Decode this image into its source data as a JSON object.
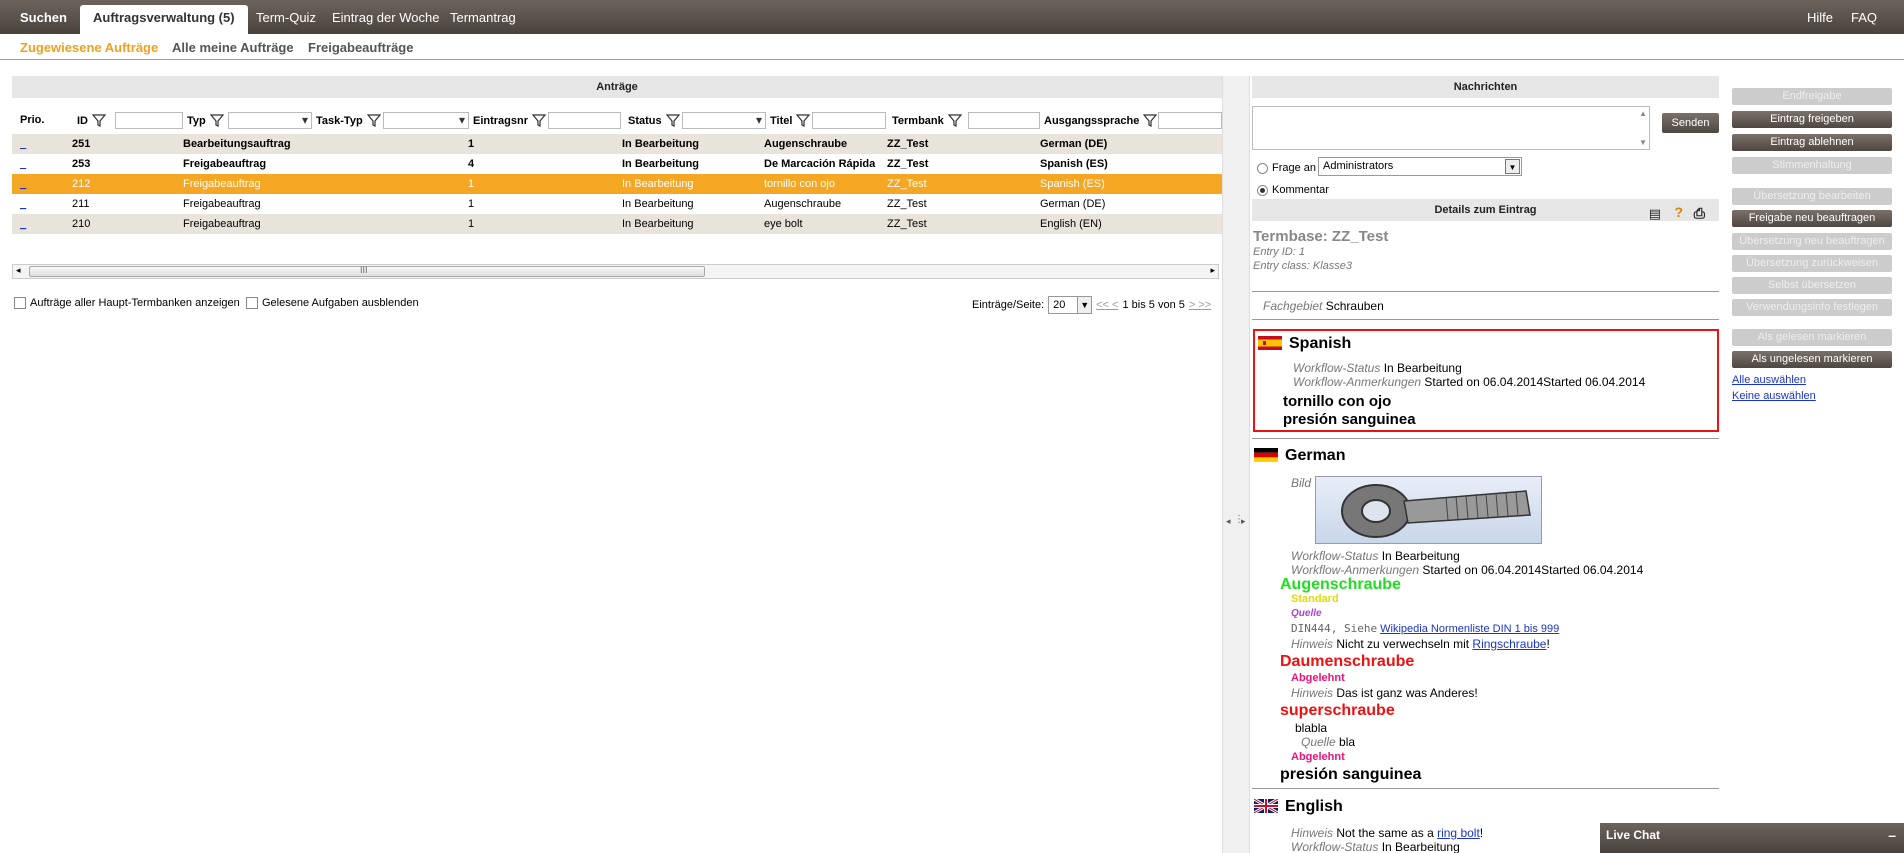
{
  "topnav": {
    "items": [
      "Suchen",
      "Auftragsverwaltung (5)",
      "Term-Quiz",
      "Eintrag der Woche",
      "Termantrag"
    ],
    "right": [
      "Hilfe",
      "FAQ"
    ]
  },
  "subnav": [
    "Zugewiesene Aufträge",
    "Alle meine Aufträge",
    "Freigabeaufträge"
  ],
  "left": {
    "title": "Anträge",
    "columns": [
      "Prio.",
      "ID",
      "Typ",
      "Task-Typ",
      "Eintragsnr",
      "Status",
      "Titel",
      "Termbank",
      "Ausgangssprache"
    ],
    "rows": [
      {
        "prio": "_",
        "id": "251",
        "typ": "Bearbeitungsauftrag",
        "nr": "1",
        "status": "In Bearbeitung",
        "titel": "Augenschraube",
        "termbank": "ZZ_Test",
        "sprache": "German (DE)"
      },
      {
        "prio": "_",
        "id": "253",
        "typ": "Freigabeauftrag",
        "nr": "4",
        "status": "In Bearbeitung",
        "titel": "De Marcación Rápida",
        "termbank": "ZZ_Test",
        "sprache": "Spanish (ES)"
      },
      {
        "prio": "_",
        "id": "212",
        "typ": "Freigabeauftrag",
        "nr": "1",
        "status": "In Bearbeitung",
        "titel": "tornillo con ojo",
        "termbank": "ZZ_Test",
        "sprache": "Spanish (ES)"
      },
      {
        "prio": "_",
        "id": "211",
        "typ": "Freigabeauftrag",
        "nr": "1",
        "status": "In Bearbeitung",
        "titel": "Augenschraube",
        "termbank": "ZZ_Test",
        "sprache": "German (DE)"
      },
      {
        "prio": "_",
        "id": "210",
        "typ": "Freigabeauftrag",
        "nr": "1",
        "status": "In Bearbeitung",
        "titel": "eye bolt",
        "termbank": "ZZ_Test",
        "sprache": "English (EN)"
      }
    ],
    "scroll_label": "III",
    "check_all_label": "Aufträge aller Haupt-Termbanken anzeigen",
    "check_read_label": "Gelesene Aufgaben ausblenden",
    "per_page_label": "Einträge/Seite:",
    "per_page_value": "20",
    "pager_prev": "<< <",
    "pager_text": "1 bis 5 von 5",
    "pager_next": "> >>"
  },
  "messages": {
    "title": "Nachrichten",
    "send": "Senden",
    "ask_label": "Frage an",
    "ask_value": "Administrators",
    "comment_label": "Kommentar"
  },
  "details": {
    "title": "Details zum Eintrag",
    "termbase": "Termbase: ZZ_Test",
    "entry_id": "Entry ID: 1",
    "entry_class": "Entry class: Klasse3",
    "fach_label": "Fachgebiet",
    "fach_value": "Schrauben",
    "spanish": {
      "lang": "Spanish",
      "ws_label": "Workflow-Status",
      "ws_value": "In Bearbeitung",
      "wa_label": "Workflow-Anmerkungen",
      "wa_value": "Started on 06.04.2014Started 06.04.2014",
      "term1": "tornillo con ojo",
      "term2": "presión sanguinea"
    },
    "german": {
      "lang": "German",
      "bild_label": "Bild",
      "ws_label": "Workflow-Status",
      "ws_value": "In Bearbeitung",
      "wa_label": "Workflow-Anmerkungen",
      "wa_value": "Started on 06.04.2014Started 06.04.2014",
      "t1": "Augenschraube",
      "t1_status": "Standard",
      "t1_quelle": "Quelle",
      "t1_src": "DIN444, Siehe",
      "t1_link": "Wikipedia Normenliste DIN 1 bis 999",
      "hinweis_label": "Hinweis",
      "t1_hinweis": "Nicht zu verwechseln mit",
      "t1_hinweis_link": "Ringschraube",
      "t1_hinweis_end": "!",
      "t2": "Daumenschraube",
      "t2_status": "Abgelehnt",
      "t2_hinweis": "Das ist ganz was Anderes!",
      "t3": "superschraube",
      "t3_text": "blabla",
      "t3_quelle_label": "Quelle",
      "t3_quelle": "bla",
      "t3_status": "Abgelehnt",
      "t4": "presión sanguinea"
    },
    "english": {
      "lang": "English",
      "hinweis_label": "Hinweis",
      "hinweis": "Not the same as a",
      "hinweis_link": "ring bolt",
      "hinweis_end": "!",
      "ws_label": "Workflow-Status",
      "ws_value": "In Bearbeitung"
    }
  },
  "actions": {
    "buttons": [
      {
        "label": "Endfreigabe",
        "enabled": false
      },
      {
        "label": "Eintrag freigeben",
        "enabled": true
      },
      {
        "label": "Eintrag ablehnen",
        "enabled": true
      },
      {
        "label": "Stimmenhaltung",
        "enabled": false
      },
      {
        "label": "Übersetzung bearbeiten",
        "enabled": false
      },
      {
        "label": "Freigabe neu beauftragen",
        "enabled": true
      },
      {
        "label": "Übersetzung neu beauftragen",
        "enabled": false
      },
      {
        "label": "Übersetzung zurückweisen",
        "enabled": false
      },
      {
        "label": "Selbst übersetzen",
        "enabled": false
      },
      {
        "label": "Verwendungsinfo festlegen",
        "enabled": false
      },
      {
        "label": "Als gelesen markieren",
        "enabled": false
      },
      {
        "label": "Als ungelesen markieren",
        "enabled": true
      }
    ],
    "select_all": "Alle auswählen",
    "select_none": "Keine auswählen"
  },
  "livechat": {
    "title": "Live Chat",
    "minimize": "–"
  },
  "colors": {
    "accent": "#f5a623",
    "nav": "#5a524b",
    "term_green": "#22dd22",
    "term_red": "#ee1111",
    "status_yellow": "#dddd00",
    "status_pink": "#ee1177",
    "highlight_border": "#ee1111"
  }
}
